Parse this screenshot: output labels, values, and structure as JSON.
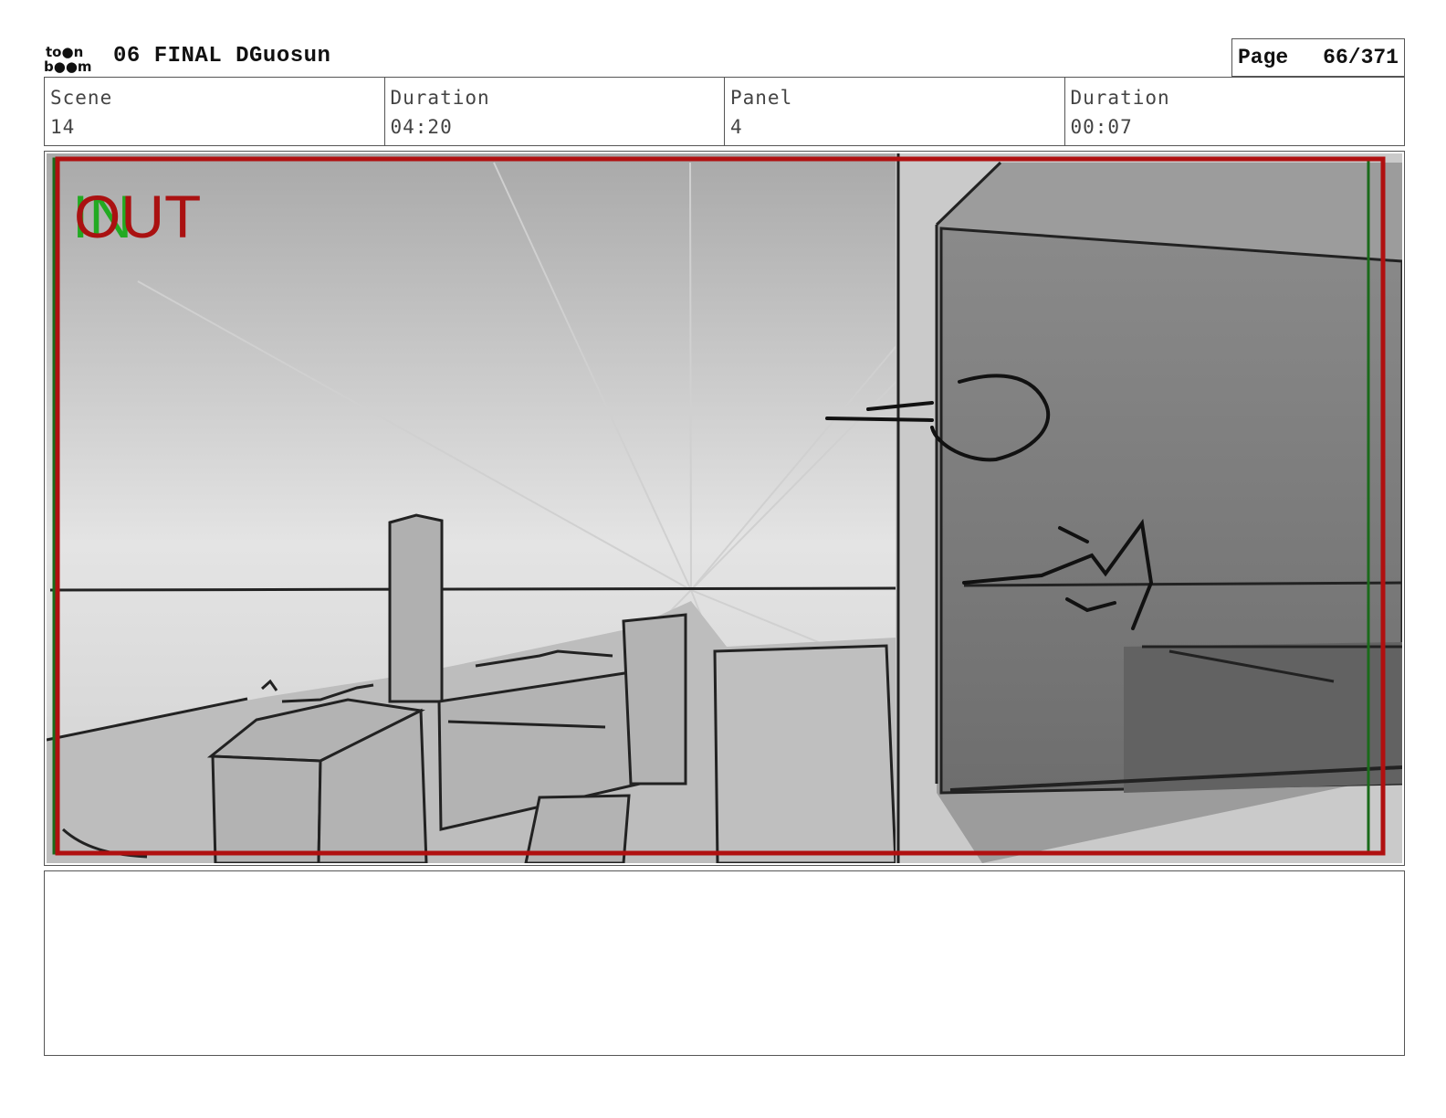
{
  "header": {
    "logo_text_top": "to●n",
    "logo_text_bottom": "b●●m",
    "project_title": "06 FINAL DGuosun",
    "page_label": "Page",
    "page_value": "66/371"
  },
  "info": {
    "scene_label": "Scene",
    "scene_value": "14",
    "scene_duration_label": "Duration",
    "scene_duration_value": "04:20",
    "panel_label": "Panel",
    "panel_value": "4",
    "panel_duration_label": "Duration",
    "panel_duration_value": "00:07"
  },
  "panel": {
    "in_marker": "IN",
    "out_marker": "OUT",
    "in_color": "#22aa22",
    "out_color": "#aa1111",
    "safe_frame_color": "#b01010",
    "title_safe_color": "#1a6a1a"
  },
  "notes": {
    "text": ""
  }
}
